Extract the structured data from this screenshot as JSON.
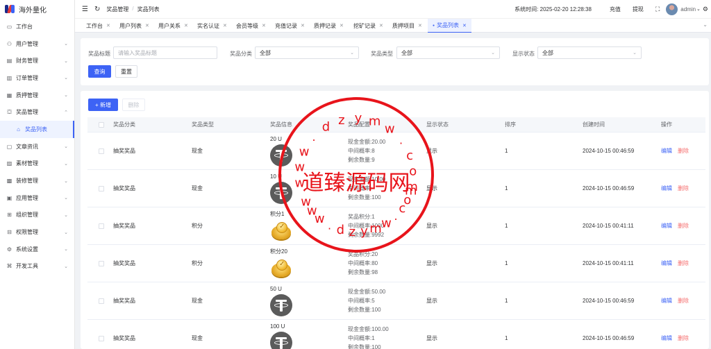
{
  "app": {
    "title": "海外量化"
  },
  "sidebar": {
    "items": [
      {
        "label": "工作台",
        "icon": "monitor-icon",
        "chev": ""
      },
      {
        "label": "用户管理",
        "icon": "user-icon",
        "chev": "⌄"
      },
      {
        "label": "财务管理",
        "icon": "wallet-icon",
        "chev": "⌄"
      },
      {
        "label": "订单管理",
        "icon": "order-icon",
        "chev": "⌄"
      },
      {
        "label": "质押管理",
        "icon": "pledge-icon",
        "chev": "⌄"
      },
      {
        "label": "奖品管理",
        "icon": "gift-icon",
        "chev": "⌃"
      },
      {
        "label": "奖品列表",
        "icon": "bag-icon",
        "chev": "",
        "sub": true
      },
      {
        "label": "文章资讯",
        "icon": "document-icon",
        "chev": "⌄"
      },
      {
        "label": "素材管理",
        "icon": "image-icon",
        "chev": "⌄"
      },
      {
        "label": "装修管理",
        "icon": "decor-icon",
        "chev": "⌄"
      },
      {
        "label": "应用管理",
        "icon": "app-icon",
        "chev": "⌄"
      },
      {
        "label": "组织管理",
        "icon": "org-icon",
        "chev": "⌄"
      },
      {
        "label": "权限管理",
        "icon": "lock-icon",
        "chev": "⌄"
      },
      {
        "label": "系统设置",
        "icon": "gear-icon",
        "chev": "⌄"
      },
      {
        "label": "开发工具",
        "icon": "code-icon",
        "chev": "⌄"
      }
    ]
  },
  "header": {
    "breadcrumb": [
      "奖品管理",
      "奖品列表"
    ],
    "system_time_label": "系统时间:",
    "system_time": "2025-02-20 12:28:38",
    "recharge": "充值",
    "withdraw": "提现",
    "username": "admin"
  },
  "tags": [
    {
      "label": "工作台",
      "active": false
    },
    {
      "label": "用户列表",
      "active": false
    },
    {
      "label": "用户关系",
      "active": false
    },
    {
      "label": "实名认证",
      "active": false
    },
    {
      "label": "会员等级",
      "active": false
    },
    {
      "label": "充值记录",
      "active": false
    },
    {
      "label": "质押记录",
      "active": false
    },
    {
      "label": "挖矿记录",
      "active": false
    },
    {
      "label": "质押项目",
      "active": false
    },
    {
      "label": "奖品列表",
      "active": true
    }
  ],
  "filter": {
    "prize_title_label": "奖品标题",
    "prize_title_placeholder": "请输入奖品标题",
    "category_label": "奖品分类",
    "category_value": "全部",
    "type_label": "奖品类型",
    "type_value": "全部",
    "status_label": "显示状态",
    "status_value": "全部",
    "search_btn": "查询",
    "reset_btn": "重置"
  },
  "actions": {
    "add": "+ 新增",
    "delete": "删除"
  },
  "table": {
    "columns": [
      "奖品分类",
      "奖品类型",
      "奖品信息",
      "奖品配置",
      "显示状态",
      "排序",
      "创建时间",
      "操作"
    ],
    "rows": [
      {
        "category": "抽奖奖品",
        "type": "现金",
        "name": "20 U",
        "image": "usdt",
        "config": [
          "现金金额:20.00",
          "中间概率:8",
          "剩余数量:9"
        ],
        "status": "显示",
        "sort": "1",
        "created": "2024-10-15 00:46:59"
      },
      {
        "category": "抽奖奖品",
        "type": "现金",
        "name": "10 U",
        "image": "usdt",
        "config": [
          "现金金额:10.00",
          "中间概率:",
          "剩余数量:100"
        ],
        "status": "显示",
        "sort": "1",
        "created": "2024-10-15 00:46:59"
      },
      {
        "category": "抽奖奖品",
        "type": "积分",
        "name": "积分1",
        "image": "coin",
        "config": [
          "奖品积分:1",
          "中间概率:1000",
          "剩余数量:9992"
        ],
        "status": "显示",
        "sort": "1",
        "created": "2024-10-15 00:41:11"
      },
      {
        "category": "抽奖奖品",
        "type": "积分",
        "name": "积分20",
        "image": "coin",
        "config": [
          "奖品积分:20",
          "中间概率:80",
          "剩余数量:98"
        ],
        "status": "显示",
        "sort": "1",
        "created": "2024-10-15 00:41:11"
      },
      {
        "category": "抽奖奖品",
        "type": "现金",
        "name": "50 U",
        "image": "usdt",
        "config": [
          "现金金额:50.00",
          "中间概率:5",
          "剩余数量:100"
        ],
        "status": "显示",
        "sort": "1",
        "created": "2024-10-15 00:46:59"
      },
      {
        "category": "抽奖奖品",
        "type": "现金",
        "name": "100 U",
        "image": "usdt",
        "config": [
          "现金金额:100.00",
          "中间概率:1",
          "剩余数量:100"
        ],
        "status": "显示",
        "sort": "1",
        "created": "2024-10-15 00:46:59"
      }
    ],
    "edit": "编辑",
    "delete": "删除"
  },
  "watermark": {
    "center": "道臻源码网",
    "ring_top": "www.dzymw.com",
    "ring_bottom": "www.dzymw.com",
    "color": "#e8141b"
  }
}
